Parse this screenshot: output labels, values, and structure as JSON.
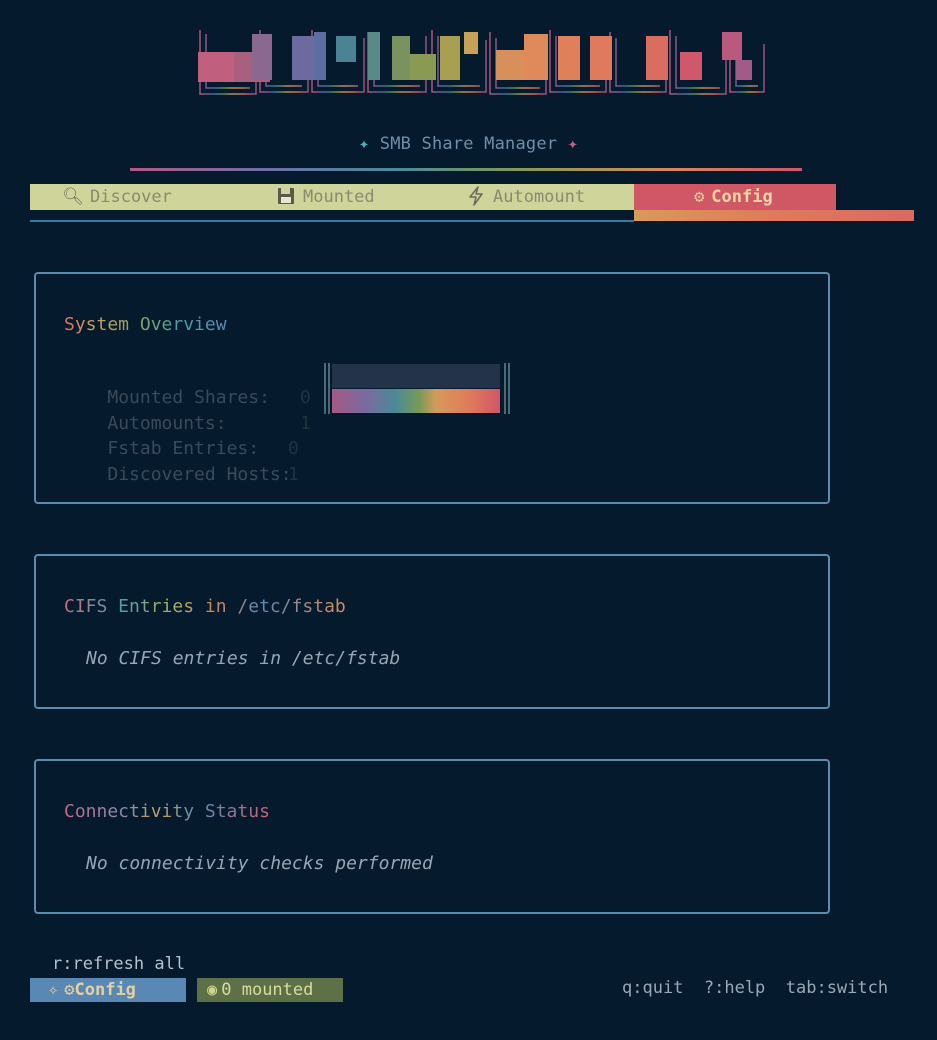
{
  "header": {
    "subtitle": "SMB Share Manager",
    "subtitle_star": "✦"
  },
  "tabs": [
    {
      "label": "Discover",
      "icon": "magnifier-icon",
      "active": false
    },
    {
      "label": "Mounted",
      "icon": "floppy-disk-icon",
      "active": false
    },
    {
      "label": "Automount",
      "icon": "lightning-icon",
      "active": false
    },
    {
      "label": "Config",
      "icon": "gear-icon",
      "active": true
    }
  ],
  "overview": {
    "title": "System Overview",
    "stats": [
      {
        "label": "Mounted Shares:",
        "value": "0"
      },
      {
        "label": "Automounts:",
        "value": "1"
      },
      {
        "label": "Fstab Entries:",
        "value": "0"
      },
      {
        "label": "Discovered Hosts:",
        "value": "1"
      }
    ]
  },
  "cifs": {
    "title": "CIFS Entries in /etc/fstab",
    "empty": "No CIFS entries in /etc/fstab"
  },
  "connectivity": {
    "title": "Connectivity Status",
    "empty": "No connectivity checks performed"
  },
  "footer": {
    "hint": "r:refresh all",
    "mode": "Config",
    "mounted": "0 mounted",
    "keys": "q:quit  ?:help  tab:switch"
  },
  "colors": {
    "background": "#061a2e",
    "active_tab": "#cf5864",
    "inactive_tab": "#cfd49a",
    "panel_border": "#5a8cb0"
  }
}
